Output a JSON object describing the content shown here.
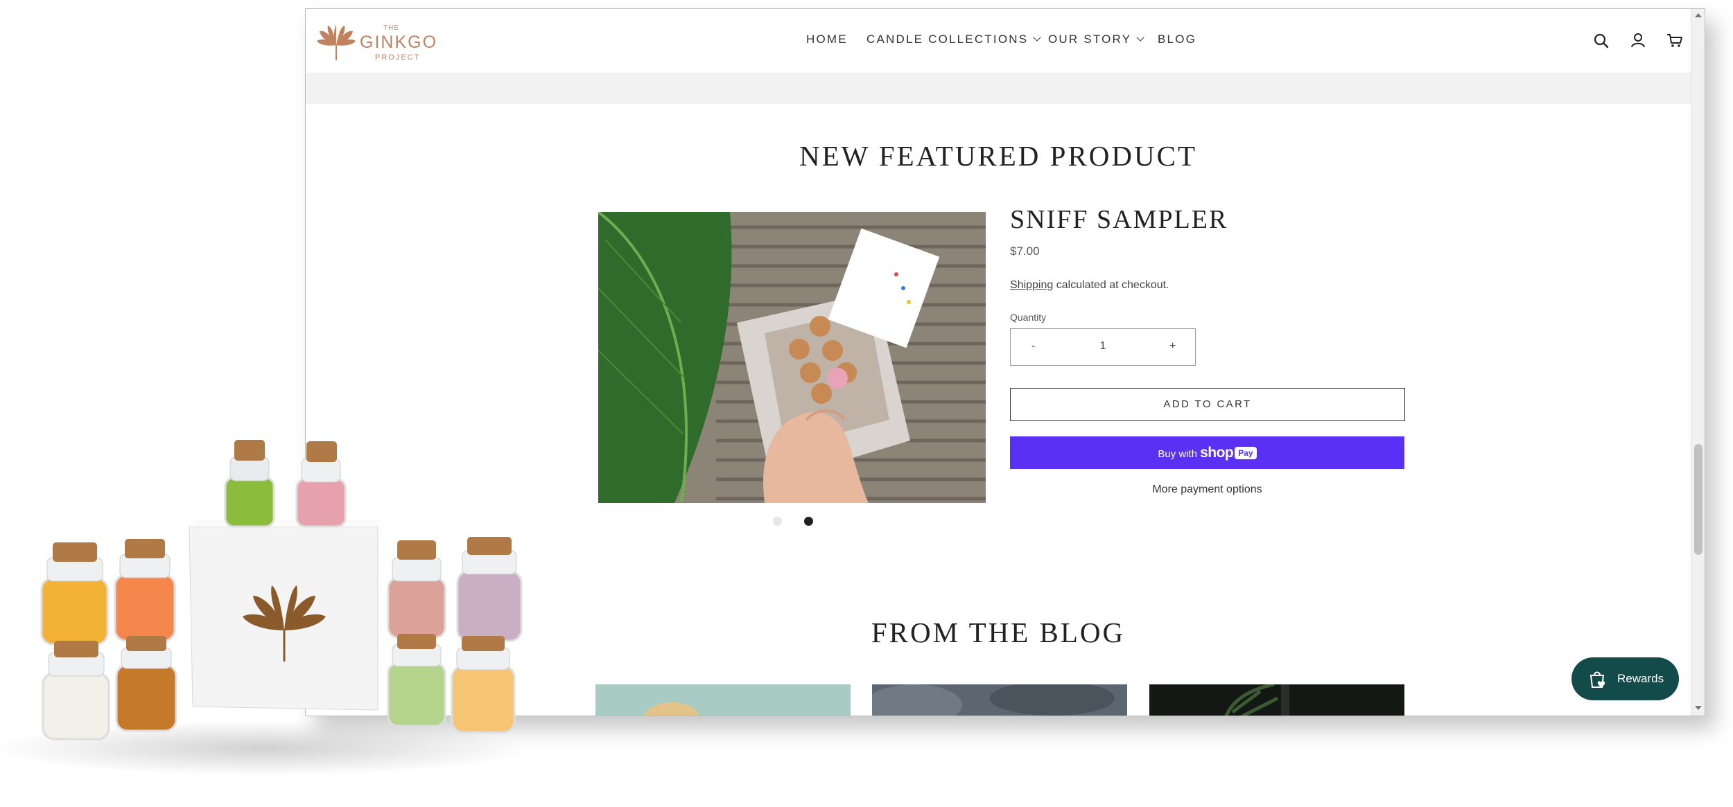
{
  "header": {
    "logo": {
      "top": "THE",
      "main": "GINKGO",
      "bottom": "PROJECT"
    },
    "nav": [
      {
        "label": "HOME",
        "dropdown": false
      },
      {
        "label": "CANDLE COLLECTIONS",
        "dropdown": true
      },
      {
        "label": "OUR STORY",
        "dropdown": true
      },
      {
        "label": "BLOG",
        "dropdown": false
      }
    ],
    "icons": [
      "search-icon",
      "account-icon",
      "cart-icon"
    ]
  },
  "featured": {
    "section_title": "NEW FEATURED PRODUCT",
    "product": {
      "title": "SNIFF SAMPLER",
      "price": "$7.00",
      "shipping_link": "Shipping",
      "shipping_rest": "calculated at checkout.",
      "quantity_label": "Quantity",
      "quantity_minus": "-",
      "quantity_value": "1",
      "quantity_plus": "+",
      "add_to_cart": "ADD TO CART",
      "shoppay_prefix": "Buy with",
      "shoppay_brand": "shop",
      "shoppay_pay": "Pay",
      "more_payment": "More payment options"
    },
    "carousel": {
      "count": 2,
      "active": 2
    }
  },
  "blog": {
    "section_title": "FROM THE BLOG"
  },
  "rewards": {
    "label": "Rewards"
  },
  "colors": {
    "accent_logo": "#c0825f",
    "shoppay": "#5a31f4",
    "rewards_bg": "#134b4b"
  }
}
